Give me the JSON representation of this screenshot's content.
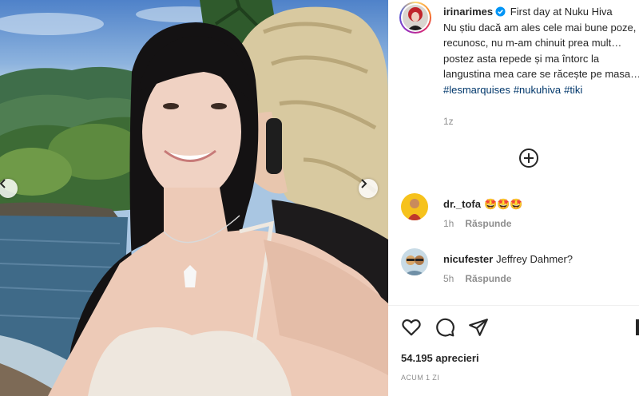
{
  "post": {
    "author": "irinarimes",
    "verified_icon": "verified-badge-icon",
    "caption_line1": "First day at Nuku Hiva",
    "caption_body": "Nu știu dacă am ales cele mai bune poze, recunosc, nu m-am chinuit prea mult… postez asta repede și ma întorc la langustina mea care se răcește pe masa…",
    "hashtags": [
      "#lesmarquises",
      "#nukuhiva",
      "#tiki"
    ],
    "time": "1z"
  },
  "comments": [
    {
      "user": "dr._tofa",
      "text": "🤩🤩🤩",
      "time": "1h",
      "reply": "Răspunde"
    },
    {
      "user": "nicufester",
      "text": "Jeffrey Dahmer?",
      "time": "5h",
      "reply": "Răspunde"
    }
  ],
  "actions": {
    "like_icon": "heart-icon",
    "comment_icon": "comment-icon",
    "share_icon": "send-icon",
    "load_more_icon": "plus-circle-icon"
  },
  "likes": "54.195 aprecieri",
  "posted": "ACUM 1 ZI",
  "colors": {
    "text": "#262626",
    "muted": "#8e8e8e",
    "hashtag": "#00376b",
    "verified": "#0095f6"
  }
}
